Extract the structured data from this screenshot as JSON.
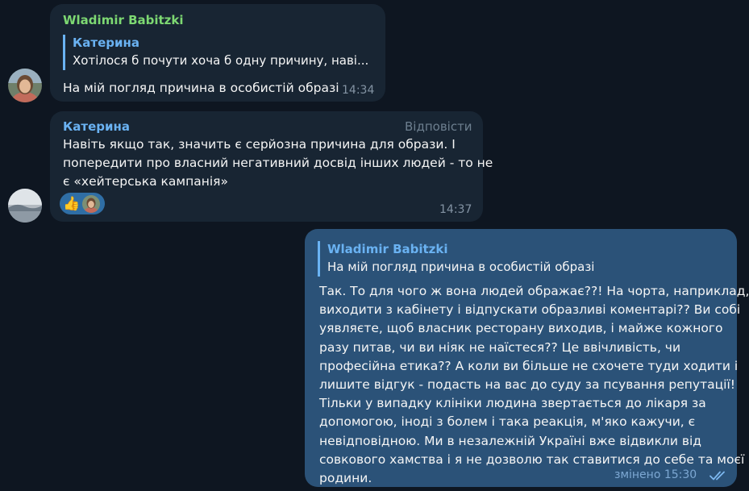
{
  "messages": [
    {
      "sender": "Wladimir Babitzki",
      "sender_color": "#7dd872",
      "reply": {
        "name": "Катерина",
        "text": "Хотілося б почути хоча б одну причину, наві..."
      },
      "text": "На мій погляд причина в особистій образі",
      "time": "14:34",
      "avatar": "user-photo-icon"
    },
    {
      "sender": "Катерина",
      "sender_color": "#6ab2f2",
      "reply_link": "Відповісти",
      "text_lines": [
        "Навіть якщо так, значить є серйозна причина для образи. І",
        "попередити про власний негативний досвід інших людей - то не",
        "є «хейтерська кампанія»"
      ],
      "reactions": {
        "emoji": "👍",
        "icon": "thumbs-up-icon"
      },
      "time": "14:37",
      "avatar": "landscape-photo-icon"
    },
    {
      "outgoing": true,
      "reply": {
        "name": "Wladimir Babitzki",
        "text": "На мій погляд причина в особистій образі"
      },
      "text_lines": [
        "Так. То для чого ж вона людей ображає??! На чорта, наприклад,",
        "виходити з кабінету і відпускати образливі коментарі?? Ви собі",
        "уявляєте, щоб власник ресторану виходив, і майже кожного",
        "разу питав, чи ви ніяк не наїстеся?? Це ввічливість, чи",
        "професійна етика?? А коли ви більше не схочете туди ходити і",
        "лишите відгук - подасть на вас до суду за псування репутації!",
        "Тільки у випадку клініки людина звертається до лікаря за",
        "допомогою, іноді з болем і така реакція, м'яко кажучи, є",
        "невідповідною. Ми в незалежній Україні вже відвикли від",
        "совкового хамства і я не дозволю так ставитися до себе та моєї",
        "родини."
      ],
      "status": "змінено 15:30",
      "read_icon": "double-check-icon"
    }
  ]
}
